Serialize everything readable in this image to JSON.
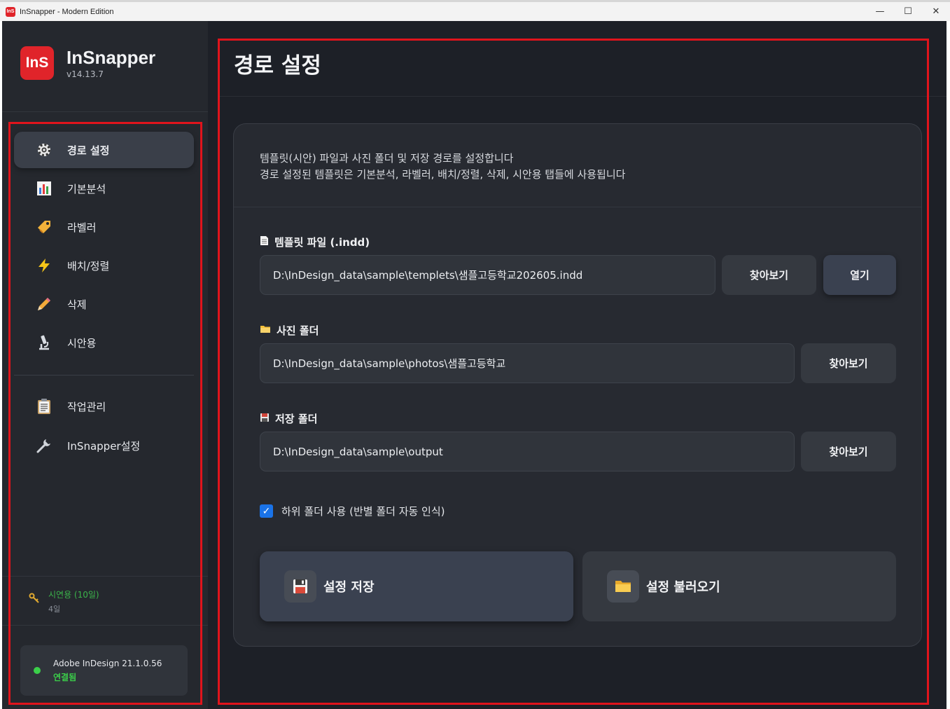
{
  "window": {
    "title": "InSnapper - Modern Edition",
    "logo_text": "InS",
    "minimize": "—",
    "maximize": "☐",
    "close": "✕"
  },
  "brand": {
    "logo_text": "InS",
    "name": "InSnapper",
    "version": "v14.13.7"
  },
  "nav": {
    "items": [
      {
        "label": "경로 설정",
        "icon": "gear-icon"
      },
      {
        "label": "기본분석",
        "icon": "bar-chart-icon"
      },
      {
        "label": "라벨러",
        "icon": "tag-icon"
      },
      {
        "label": "배치/정렬",
        "icon": "lightning-icon"
      },
      {
        "label": "삭제",
        "icon": "pencil-icon"
      },
      {
        "label": "시안용",
        "icon": "microscope-icon"
      }
    ],
    "extra": [
      {
        "label": "작업관리",
        "icon": "clipboard-icon"
      },
      {
        "label": "InSnapper설정",
        "icon": "wrench-icon"
      }
    ]
  },
  "trial": {
    "title": "시연용 (10일)",
    "remaining": "4일"
  },
  "connection": {
    "app": "Adobe InDesign 21.1.0.56",
    "status": "연결됨",
    "status_color": "#3bd04a"
  },
  "main": {
    "title": "경로 설정",
    "desc_line1": "템플릿(시안) 파일과 사진 폴더 및 저장 경로를 설정합니다",
    "desc_line2": "경로 설정된 템플릿은 기본분석, 라벨러, 배치/정렬, 삭제, 시안용 탭들에 사용됩니다",
    "template": {
      "label": "템플릿 파일 (.indd)",
      "value": "D:\\InDesign_data\\sample\\templets\\샘플고등학교202605.indd",
      "browse": "찾아보기",
      "open": "열기"
    },
    "photos": {
      "label": "사진 폴더",
      "value": "D:\\InDesign_data\\sample\\photos\\샘플고등학교",
      "browse": "찾아보기"
    },
    "output": {
      "label": "저장 폴더",
      "value": "D:\\InDesign_data\\sample\\output",
      "browse": "찾아보기"
    },
    "subfolder": {
      "label": "하위 폴더 사용 (반별 폴더 자동 인식)",
      "checked": true
    },
    "save_button": "설정 저장",
    "load_button": "설정 불러오기"
  },
  "colors": {
    "accent_red": "#e0242a",
    "checkbox_blue": "#1a73e8"
  }
}
